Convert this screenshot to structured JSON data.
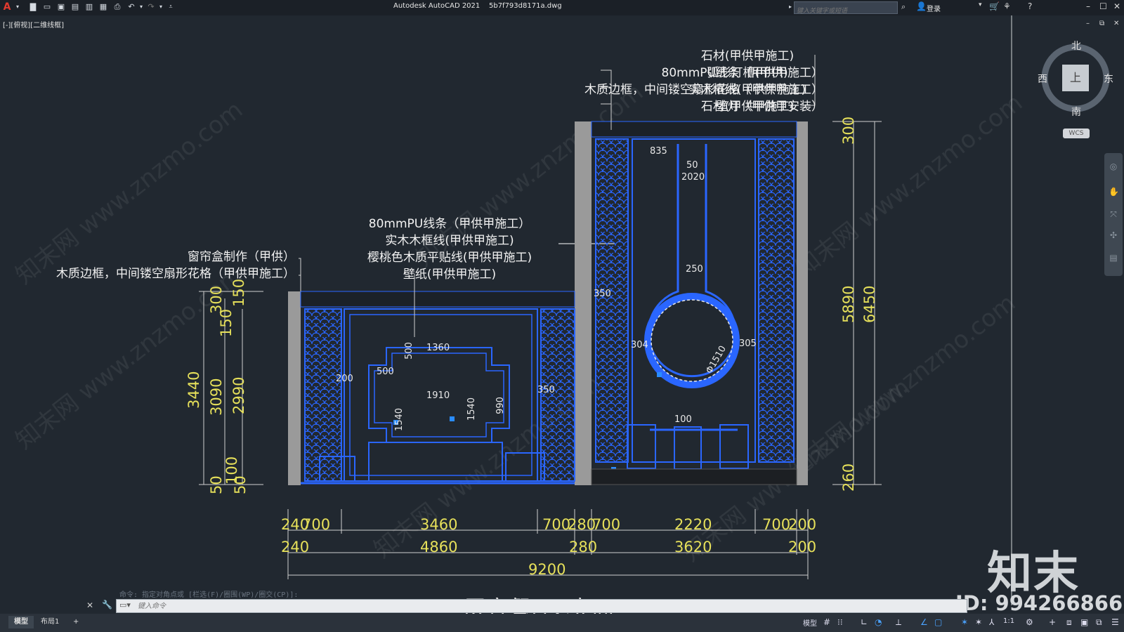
{
  "window": {
    "title": "Autodesk AutoCAD 2021    5b7f793d8171a.dwg",
    "search_placeholder": "键入关键字或短语",
    "login_label": "登录",
    "viewport_label": "[-][俯视][二维线框]"
  },
  "annotations": {
    "right_group": [
      "石材(甲供甲施工)",
      "弧形灯槽(甲供)",
      "实木框线(甲供甲施工)",
      "石材(甲供甲施工)"
    ],
    "top_mid_group": [
      "80mmPU线条（甲供甲施工）",
      "木质边框，中间镂空扇形花格（甲供甲施工）",
      "壁灯（甲供甲安装）"
    ],
    "mid_group": [
      "80mmPU线条（甲供甲施工）",
      "实木木框线(甲供甲施工)",
      "樱桃色木质平贴线(甲供甲施工)",
      "壁纸(甲供甲施工)"
    ],
    "left_group": [
      "窗帘盒制作（甲供）",
      "木质边框，中间镂空扇形花格（甲供甲施工）"
    ]
  },
  "dimensions": {
    "bottom_row1": [
      "240",
      "700",
      "3460",
      "700",
      "280",
      "700",
      "2220",
      "700",
      "200"
    ],
    "bottom_row2": [
      "240",
      "4860",
      "280",
      "3620",
      "200"
    ],
    "total": "9200",
    "left_vertical": [
      "300",
      "150",
      "150",
      "3440",
      "3090",
      "2990",
      "100",
      "50",
      "50"
    ],
    "right_vertical": [
      "300",
      "5890",
      "6450",
      "260"
    ],
    "inner": [
      "835",
      "50",
      "2020",
      "250",
      "304",
      "305",
      "Φ1510",
      "100",
      "200",
      "1360",
      "500",
      "500",
      "1910",
      "1540",
      "1540",
      "990",
      "350",
      "350",
      "350",
      "350",
      "350",
      "990"
    ]
  },
  "drawing_title": "一层客餐厅C立面",
  "watermark": "知末网 www.znzmo.com",
  "brand": {
    "logo": "知末",
    "id": "ID: 994266866"
  },
  "viewcube": {
    "north": "北",
    "south": "南",
    "east": "东",
    "west": "西",
    "face": "上",
    "wcs": "WCS"
  },
  "command": {
    "history": "命令: 指定对角点或 [栏选(F)/圈围(WP)/圈交(CP)]:",
    "placeholder": "键入命令"
  },
  "status": {
    "tabs": [
      "模型",
      "布局1",
      "+"
    ],
    "model_label": "模型",
    "scale": "1:1"
  },
  "colors": {
    "background": "#212830",
    "cad_blue": "#1f5cff",
    "dim_yellow": "#e6e05a",
    "wall_grey": "#9a9a9a"
  }
}
